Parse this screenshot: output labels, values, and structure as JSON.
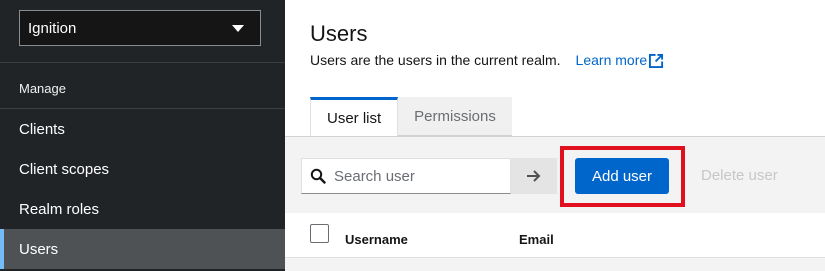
{
  "sidebar": {
    "realm_select": "Ignition",
    "group_title": "Manage",
    "items": [
      {
        "label": "Clients"
      },
      {
        "label": "Client scopes"
      },
      {
        "label": "Realm roles"
      },
      {
        "label": "Users",
        "active": true
      }
    ]
  },
  "header": {
    "title": "Users",
    "description": "Users are the users in the current realm.",
    "learn_more": "Learn more"
  },
  "tabs": [
    {
      "label": "User list",
      "active": true
    },
    {
      "label": "Permissions",
      "active": false
    }
  ],
  "toolbar": {
    "search_placeholder": "Search user",
    "add_user": "Add user",
    "delete_user": "Delete user"
  },
  "table": {
    "columns": [
      "Username",
      "Email"
    ]
  },
  "icons": {
    "search": "search-icon",
    "arrow": "arrow-right-icon",
    "external": "external-link-icon",
    "caret": "caret-down-icon"
  },
  "colors": {
    "accent": "#0066cc",
    "sidebar_bg": "#212427",
    "highlight": "#e0101e"
  }
}
